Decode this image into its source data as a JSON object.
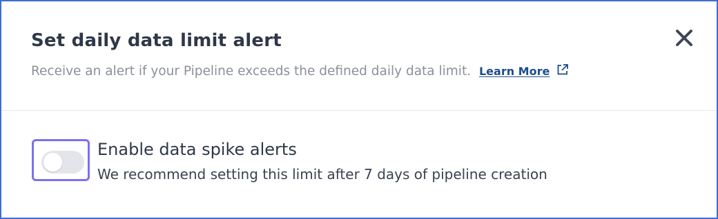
{
  "dialog": {
    "title": "Set daily data limit alert",
    "subtitle": "Receive an alert if your Pipeline exceeds the defined daily data limit.",
    "learn_more_label": "Learn More",
    "learn_more_icon": "external-link-icon",
    "close_icon": "close-icon"
  },
  "option": {
    "label": "Enable data spike alerts",
    "description": "We recommend setting this limit after 7 days of pipeline creation",
    "toggle_enabled": false,
    "focus_ring_color": "#7b6ff0",
    "track_color": "#e3e5ea"
  },
  "colors": {
    "border": "#3a6fd0",
    "title": "#2f3848",
    "subtitle": "#8a8f9a",
    "link": "#1d4e8a"
  }
}
